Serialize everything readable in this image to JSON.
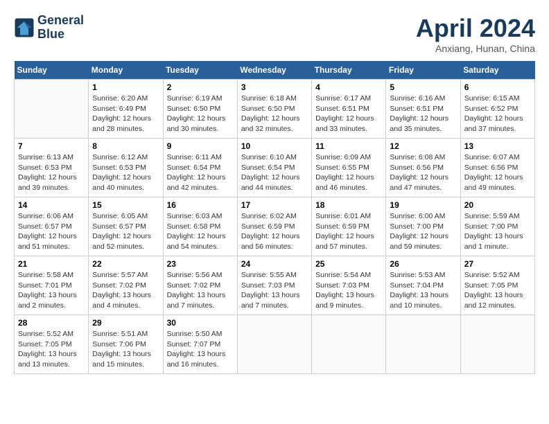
{
  "header": {
    "logo_line1": "General",
    "logo_line2": "Blue",
    "month_year": "April 2024",
    "location": "Anxiang, Hunan, China"
  },
  "weekdays": [
    "Sunday",
    "Monday",
    "Tuesday",
    "Wednesday",
    "Thursday",
    "Friday",
    "Saturday"
  ],
  "weeks": [
    [
      {
        "day": "",
        "info": ""
      },
      {
        "day": "1",
        "info": "Sunrise: 6:20 AM\nSunset: 6:49 PM\nDaylight: 12 hours\nand 28 minutes."
      },
      {
        "day": "2",
        "info": "Sunrise: 6:19 AM\nSunset: 6:50 PM\nDaylight: 12 hours\nand 30 minutes."
      },
      {
        "day": "3",
        "info": "Sunrise: 6:18 AM\nSunset: 6:50 PM\nDaylight: 12 hours\nand 32 minutes."
      },
      {
        "day": "4",
        "info": "Sunrise: 6:17 AM\nSunset: 6:51 PM\nDaylight: 12 hours\nand 33 minutes."
      },
      {
        "day": "5",
        "info": "Sunrise: 6:16 AM\nSunset: 6:51 PM\nDaylight: 12 hours\nand 35 minutes."
      },
      {
        "day": "6",
        "info": "Sunrise: 6:15 AM\nSunset: 6:52 PM\nDaylight: 12 hours\nand 37 minutes."
      }
    ],
    [
      {
        "day": "7",
        "info": "Sunrise: 6:13 AM\nSunset: 6:53 PM\nDaylight: 12 hours\nand 39 minutes."
      },
      {
        "day": "8",
        "info": "Sunrise: 6:12 AM\nSunset: 6:53 PM\nDaylight: 12 hours\nand 40 minutes."
      },
      {
        "day": "9",
        "info": "Sunrise: 6:11 AM\nSunset: 6:54 PM\nDaylight: 12 hours\nand 42 minutes."
      },
      {
        "day": "10",
        "info": "Sunrise: 6:10 AM\nSunset: 6:54 PM\nDaylight: 12 hours\nand 44 minutes."
      },
      {
        "day": "11",
        "info": "Sunrise: 6:09 AM\nSunset: 6:55 PM\nDaylight: 12 hours\nand 46 minutes."
      },
      {
        "day": "12",
        "info": "Sunrise: 6:08 AM\nSunset: 6:56 PM\nDaylight: 12 hours\nand 47 minutes."
      },
      {
        "day": "13",
        "info": "Sunrise: 6:07 AM\nSunset: 6:56 PM\nDaylight: 12 hours\nand 49 minutes."
      }
    ],
    [
      {
        "day": "14",
        "info": "Sunrise: 6:06 AM\nSunset: 6:57 PM\nDaylight: 12 hours\nand 51 minutes."
      },
      {
        "day": "15",
        "info": "Sunrise: 6:05 AM\nSunset: 6:57 PM\nDaylight: 12 hours\nand 52 minutes."
      },
      {
        "day": "16",
        "info": "Sunrise: 6:03 AM\nSunset: 6:58 PM\nDaylight: 12 hours\nand 54 minutes."
      },
      {
        "day": "17",
        "info": "Sunrise: 6:02 AM\nSunset: 6:59 PM\nDaylight: 12 hours\nand 56 minutes."
      },
      {
        "day": "18",
        "info": "Sunrise: 6:01 AM\nSunset: 6:59 PM\nDaylight: 12 hours\nand 57 minutes."
      },
      {
        "day": "19",
        "info": "Sunrise: 6:00 AM\nSunset: 7:00 PM\nDaylight: 12 hours\nand 59 minutes."
      },
      {
        "day": "20",
        "info": "Sunrise: 5:59 AM\nSunset: 7:00 PM\nDaylight: 13 hours\nand 1 minute."
      }
    ],
    [
      {
        "day": "21",
        "info": "Sunrise: 5:58 AM\nSunset: 7:01 PM\nDaylight: 13 hours\nand 2 minutes."
      },
      {
        "day": "22",
        "info": "Sunrise: 5:57 AM\nSunset: 7:02 PM\nDaylight: 13 hours\nand 4 minutes."
      },
      {
        "day": "23",
        "info": "Sunrise: 5:56 AM\nSunset: 7:02 PM\nDaylight: 13 hours\nand 7 minutes."
      },
      {
        "day": "24",
        "info": "Sunrise: 5:55 AM\nSunset: 7:03 PM\nDaylight: 13 hours\nand 7 minutes."
      },
      {
        "day": "25",
        "info": "Sunrise: 5:54 AM\nSunset: 7:03 PM\nDaylight: 13 hours\nand 9 minutes."
      },
      {
        "day": "26",
        "info": "Sunrise: 5:53 AM\nSunset: 7:04 PM\nDaylight: 13 hours\nand 10 minutes."
      },
      {
        "day": "27",
        "info": "Sunrise: 5:52 AM\nSunset: 7:05 PM\nDaylight: 13 hours\nand 12 minutes."
      }
    ],
    [
      {
        "day": "28",
        "info": "Sunrise: 5:52 AM\nSunset: 7:05 PM\nDaylight: 13 hours\nand 13 minutes."
      },
      {
        "day": "29",
        "info": "Sunrise: 5:51 AM\nSunset: 7:06 PM\nDaylight: 13 hours\nand 15 minutes."
      },
      {
        "day": "30",
        "info": "Sunrise: 5:50 AM\nSunset: 7:07 PM\nDaylight: 13 hours\nand 16 minutes."
      },
      {
        "day": "",
        "info": ""
      },
      {
        "day": "",
        "info": ""
      },
      {
        "day": "",
        "info": ""
      },
      {
        "day": "",
        "info": ""
      }
    ]
  ]
}
